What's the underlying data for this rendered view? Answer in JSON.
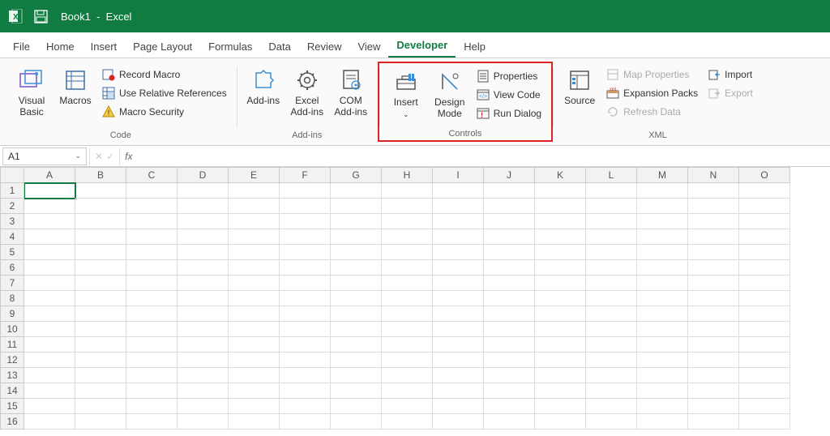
{
  "titlebar": {
    "doc": "Book1",
    "app": "Excel"
  },
  "tabs": [
    "File",
    "Home",
    "Insert",
    "Page Layout",
    "Formulas",
    "Data",
    "Review",
    "View",
    "Developer",
    "Help"
  ],
  "active_tab": "Developer",
  "ribbon": {
    "code": {
      "label": "Code",
      "visual_basic": "Visual Basic",
      "macros": "Macros",
      "record": "Record Macro",
      "relative": "Use Relative References",
      "security": "Macro Security"
    },
    "addins": {
      "label": "Add-ins",
      "addins": "Add-ins",
      "excel": "Excel Add-ins",
      "com": "COM Add-ins"
    },
    "controls": {
      "label": "Controls",
      "insert": "Insert",
      "design": "Design Mode",
      "properties": "Properties",
      "view_code": "View Code",
      "run_dialog": "Run Dialog"
    },
    "xml": {
      "label": "XML",
      "source": "Source",
      "map": "Map Properties",
      "expansion": "Expansion Packs",
      "refresh": "Refresh Data",
      "import": "Import",
      "export": "Export"
    }
  },
  "namebox": "A1",
  "columns": [
    "A",
    "B",
    "C",
    "D",
    "E",
    "F",
    "G",
    "H",
    "I",
    "J",
    "K",
    "L",
    "M",
    "N",
    "O"
  ],
  "rows": [
    "1",
    "2",
    "3",
    "4",
    "5",
    "6",
    "7",
    "8",
    "9",
    "10",
    "11",
    "12",
    "13",
    "14",
    "15",
    "16"
  ],
  "selected": {
    "col": 0,
    "row": 0
  }
}
